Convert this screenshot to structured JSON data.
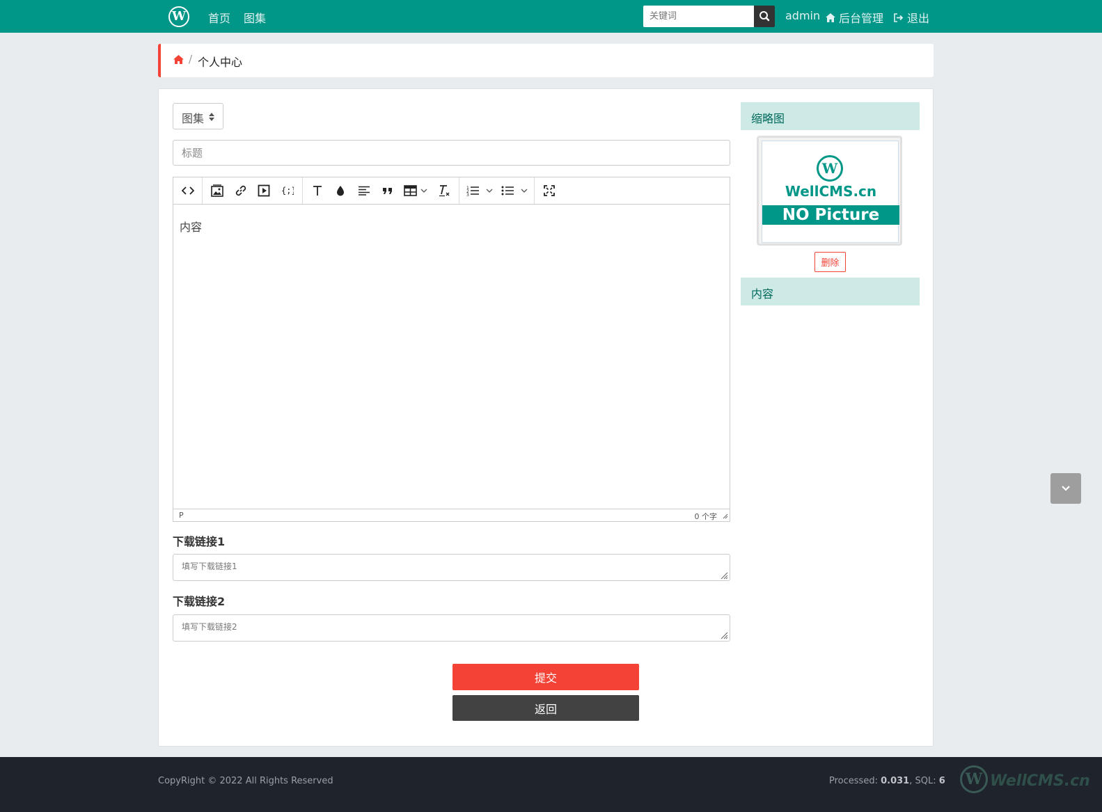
{
  "navbar": {
    "logo_letter": "W",
    "links": [
      "首页",
      "图集"
    ],
    "search_placeholder": "关键词",
    "user": "admin",
    "admin_label": "后台管理",
    "logout_label": "退出"
  },
  "breadcrumb": {
    "current": "个人中心",
    "separator": "/"
  },
  "form": {
    "category_selected": "图集",
    "title_placeholder": "标题",
    "editor": {
      "placeholder": "内容",
      "status_path": "P",
      "word_count": "0 个字"
    },
    "download1": {
      "label": "下载链接1",
      "placeholder": "填写下载链接1"
    },
    "download2": {
      "label": "下载链接2",
      "placeholder": "填写下载链接2"
    },
    "submit_label": "提交",
    "back_label": "返回"
  },
  "sidebar": {
    "thumb_heading": "缩略图",
    "thumb_logo_letter": "W",
    "thumb_brand": "WellCMS.cn",
    "thumb_banner": "NO Picture",
    "delete_label": "删除",
    "content_heading": "内容"
  },
  "footer": {
    "copyright": "CopyRight © 2022 All Rights Reserved",
    "processed_label": "Processed:",
    "processed_value": "0.031",
    "sql_label": "SQL:",
    "sql_value": "6",
    "brand_logo_letter": "W",
    "brand": "WellCMS.cn"
  },
  "colors": {
    "primary": "#009688",
    "danger": "#f44336",
    "dark": "#424242",
    "footer_bg": "#1f232b"
  },
  "toolbar_icons": [
    "code-view-icon",
    "image-icon",
    "link-icon",
    "video-icon",
    "code-block-icon",
    "font-size-icon",
    "text-color-icon",
    "align-icon",
    "quote-icon",
    "table-icon",
    "clear-format-icon",
    "ordered-list-icon",
    "unordered-list-icon",
    "fullscreen-icon"
  ]
}
